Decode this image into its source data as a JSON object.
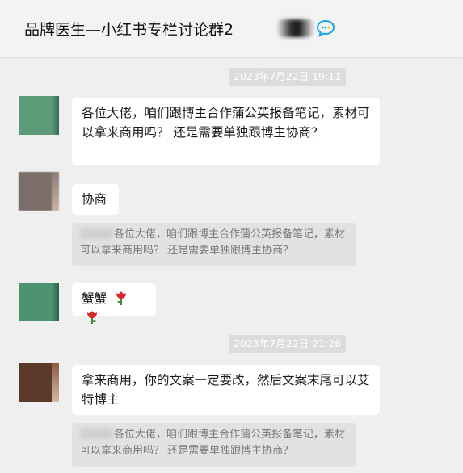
{
  "header": {
    "title": "品牌医生—小红书专栏讨论群2",
    "chat_icon": "chat-bubble-icon"
  },
  "timestamps": [
    "2023年7月22日 19:11",
    "2023年7月22日 21:26"
  ],
  "messages": [
    {
      "text": "各位大佬，咱们跟博主合作蒲公英报备笔记，素材可以拿来商用吗？ 还是需要单独跟博主协商？"
    },
    {
      "text": "协商",
      "quote": "各位大佬，咱们跟博主合作蒲公英报备笔记，素材可以拿来商用吗？ 还是需要单独跟博主协商？"
    },
    {
      "text": "蟹蟹",
      "emoji": "rose-icon"
    },
    {
      "text": "拿来商用，你的文案一定要改，然后文案末尾可以艾特博主",
      "quote": "各位大佬，咱们跟博主合作蒲公英报备笔记，素材可以拿来商用吗？ 还是需要单独跟博主协商？"
    }
  ],
  "colors": {
    "background": "#efefef",
    "bubble": "#ffffff",
    "quote_bg": "#e2e2e2",
    "timestamp_bg": "#dcdcdc"
  }
}
